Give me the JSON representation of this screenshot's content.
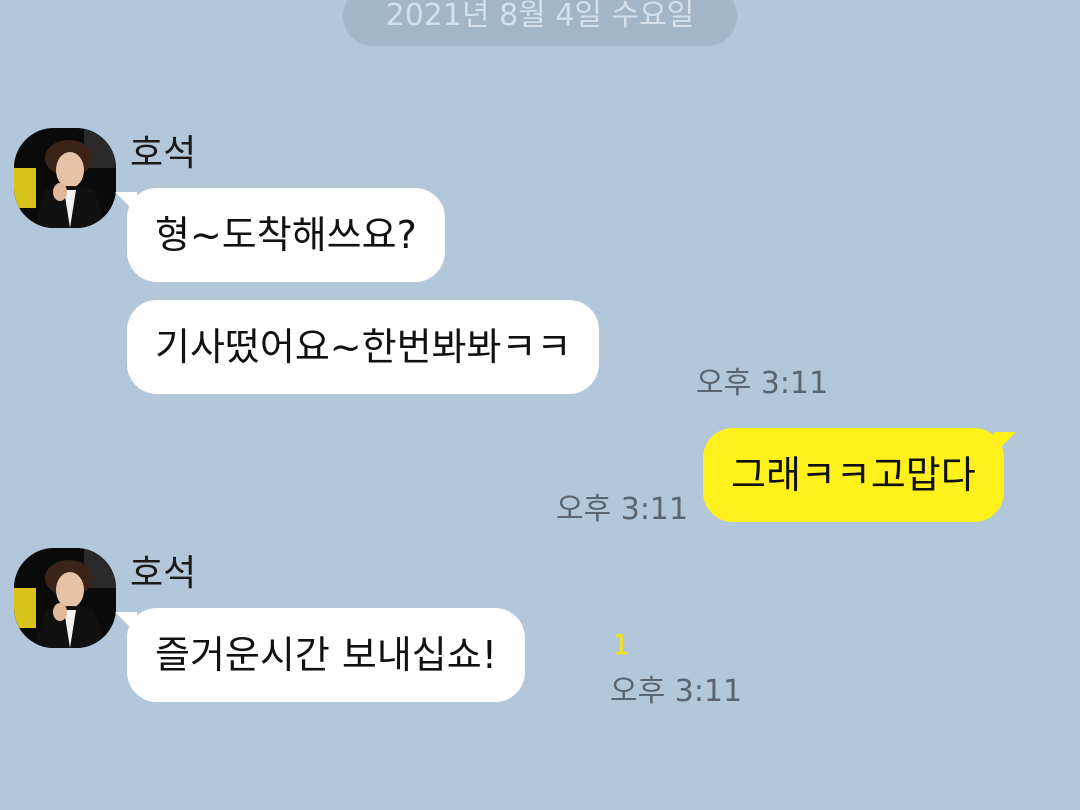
{
  "date_divider": "2021년 8월 4일 수요일",
  "messages": [
    {
      "sender": "호석",
      "bubbles": [
        "형~도착해쓰요?",
        "기사떴어요~한번봐봐ㅋㅋ"
      ],
      "time": "오후 3:11"
    },
    {
      "outgoing_text": "그래ㅋㅋ고맙다",
      "time": "오후 3:11"
    },
    {
      "sender": "호석",
      "bubbles": [
        "즐거운시간 보내십쇼!"
      ],
      "unread": "1",
      "time": "오후 3:11"
    }
  ],
  "colors": {
    "background": "#b2c7da",
    "incoming_bubble": "#ffffff",
    "outgoing_bubble": "#fef01b",
    "unread": "#f2e017"
  },
  "icons": {
    "avatar": "profile-photo"
  }
}
